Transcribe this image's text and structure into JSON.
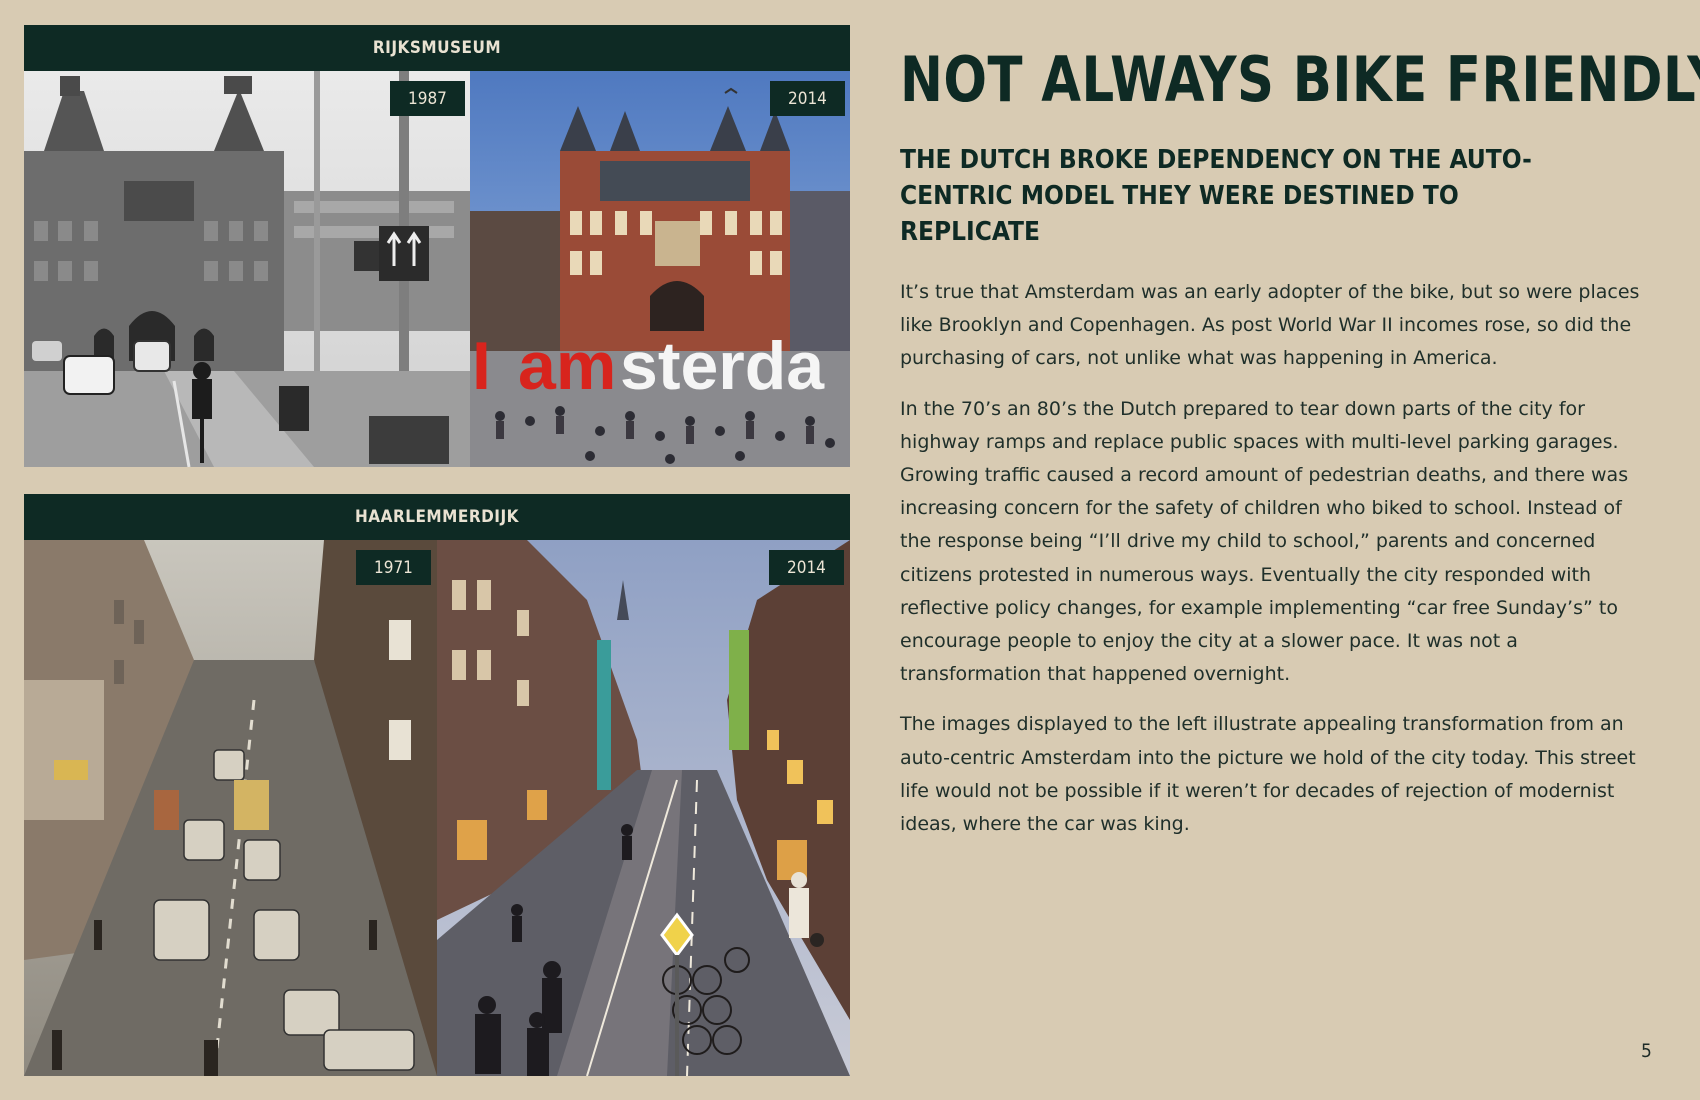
{
  "page": {
    "number": "5"
  },
  "panels": [
    {
      "header": "RIJKSMUSEUM",
      "photos": [
        {
          "year": "1987",
          "sign_text": "I amsterdam"
        },
        {
          "year": "2014",
          "sign_text": "I amsterdam"
        }
      ]
    },
    {
      "header": "HAARLEMMERDIJK",
      "photos": [
        {
          "year": "1971"
        },
        {
          "year": "2014"
        }
      ]
    }
  ],
  "article": {
    "title": "NOT ALWAYS BIKE FRIENDLY",
    "subtitle": "THE DUTCH BROKE DEPENDENCY ON THE AUTO-CENTRIC MODEL THEY WERE DESTINED TO REPLICATE",
    "paragraphs": [
      "It’s true that Amsterdam was an early adopter of the bike, but so were places like Brooklyn and Copenhagen. As post World War II incomes rose, so did the purchasing of cars, not unlike what was happening in America.",
      "In the 70’s an 80’s the Dutch prepared to tear down parts of the city for highway ramps and replace public spaces with multi-level parking garages. Growing traffic caused a record amount of pedestrian deaths, and there was increasing concern for the safety of children who biked to school. Instead of the response being “I’ll drive my child to school,” parents and concerned citizens protested in numerous ways. Eventually the city responded with reflective policy changes, for example implementing “car free Sunday’s” to encourage people to enjoy the city at a slower pace. It was not a transformation that happened overnight.",
      "The images displayed to the left illustrate appealing transformation from an auto-centric Amsterdam into the picture we hold of the city today. This street life would not be possible if it weren’t for decades of rejection of modernist ideas, where the car was king."
    ]
  }
}
